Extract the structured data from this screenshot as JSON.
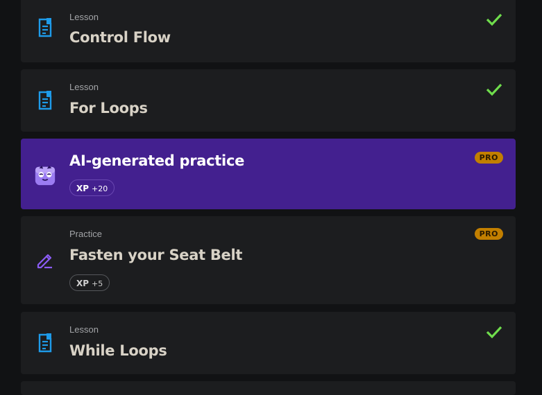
{
  "items": [
    {
      "kind": "Lesson",
      "title": "Control Flow",
      "icon": "lesson-doc-icon",
      "completed": true
    },
    {
      "kind": "Lesson",
      "title": "For Loops",
      "icon": "lesson-doc-icon",
      "completed": true
    },
    {
      "kind": "",
      "title": "AI-generated practice",
      "icon": "ai-mascot-icon",
      "badge": "PRO",
      "xp_label": "XP",
      "xp_amount": "+20"
    },
    {
      "kind": "Practice",
      "title": "Fasten your Seat Belt",
      "icon": "pencil-icon",
      "badge": "PRO",
      "xp_label": "XP",
      "xp_amount": "+5"
    },
    {
      "kind": "Lesson",
      "title": "While Loops",
      "icon": "lesson-doc-icon",
      "completed": true
    }
  ],
  "colors": {
    "accent_blue": "#1e9be9",
    "check_green": "#6fdd4c",
    "pro_orange": "#c27f00",
    "ai_card_purple": "#43208f",
    "practice_purple": "#8b5cf6"
  }
}
